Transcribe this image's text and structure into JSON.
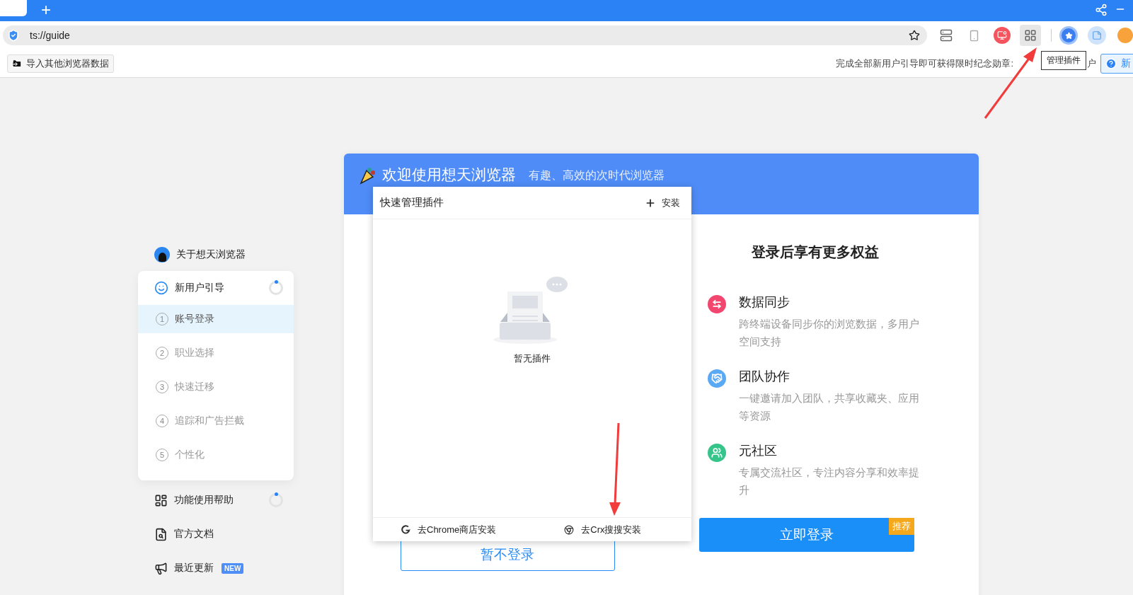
{
  "browser": {
    "new_tab": "+",
    "url": "ts://guide",
    "tooltip": "管理插件"
  },
  "bookmark_bar": {
    "import_button": "导入其他浏览器数据",
    "promo_text": "完成全部新用户引导即可获得限时纪念勋章:",
    "promo_tail": "户",
    "help_button": "新"
  },
  "sidebar": {
    "about": "关于想天浏览器",
    "guide": {
      "label": "新用户引导",
      "steps": [
        {
          "number": "1",
          "label": "账号登录",
          "selected": true
        },
        {
          "number": "2",
          "label": "职业选择",
          "selected": false
        },
        {
          "number": "3",
          "label": "快速迁移",
          "selected": false
        },
        {
          "number": "4",
          "label": "追踪和广告拦截",
          "selected": false
        },
        {
          "number": "5",
          "label": "个性化",
          "selected": false
        }
      ]
    },
    "items": [
      {
        "kind": "help",
        "label": "功能使用帮助"
      },
      {
        "kind": "docs",
        "label": "官方文档"
      },
      {
        "kind": "updates",
        "label": "最近更新",
        "badge": "NEW"
      }
    ]
  },
  "welcome": {
    "title": "欢迎使用想天浏览器",
    "subtitle": "有趣、高效的次时代浏览器",
    "skip_button": "暂不登录",
    "benefits": {
      "title": "登录后享有更多权益",
      "items": [
        {
          "kind": "sync",
          "color": "#f2466f",
          "title": "数据同步",
          "description": "跨终端设备同步你的浏览数据，多用户空间支持"
        },
        {
          "kind": "team",
          "color": "#5aa9f5",
          "title": "团队协作",
          "description": "一键邀请加入团队，共享收藏夹、应用等资源"
        },
        {
          "kind": "community",
          "color": "#35c48a",
          "title": "元社区",
          "description": "专属交流社区，专注内容分享和效率提升"
        }
      ]
    },
    "login_button": "立即登录",
    "login_badge": "推荐"
  },
  "extensions_popup": {
    "title": "快速管理插件",
    "install_button": "安装",
    "empty_text": "暂无插件",
    "links": [
      {
        "kind": "chrome",
        "label": "去Chrome商店安装"
      },
      {
        "kind": "crx",
        "label": "去Crx搜搜安装"
      }
    ]
  }
}
